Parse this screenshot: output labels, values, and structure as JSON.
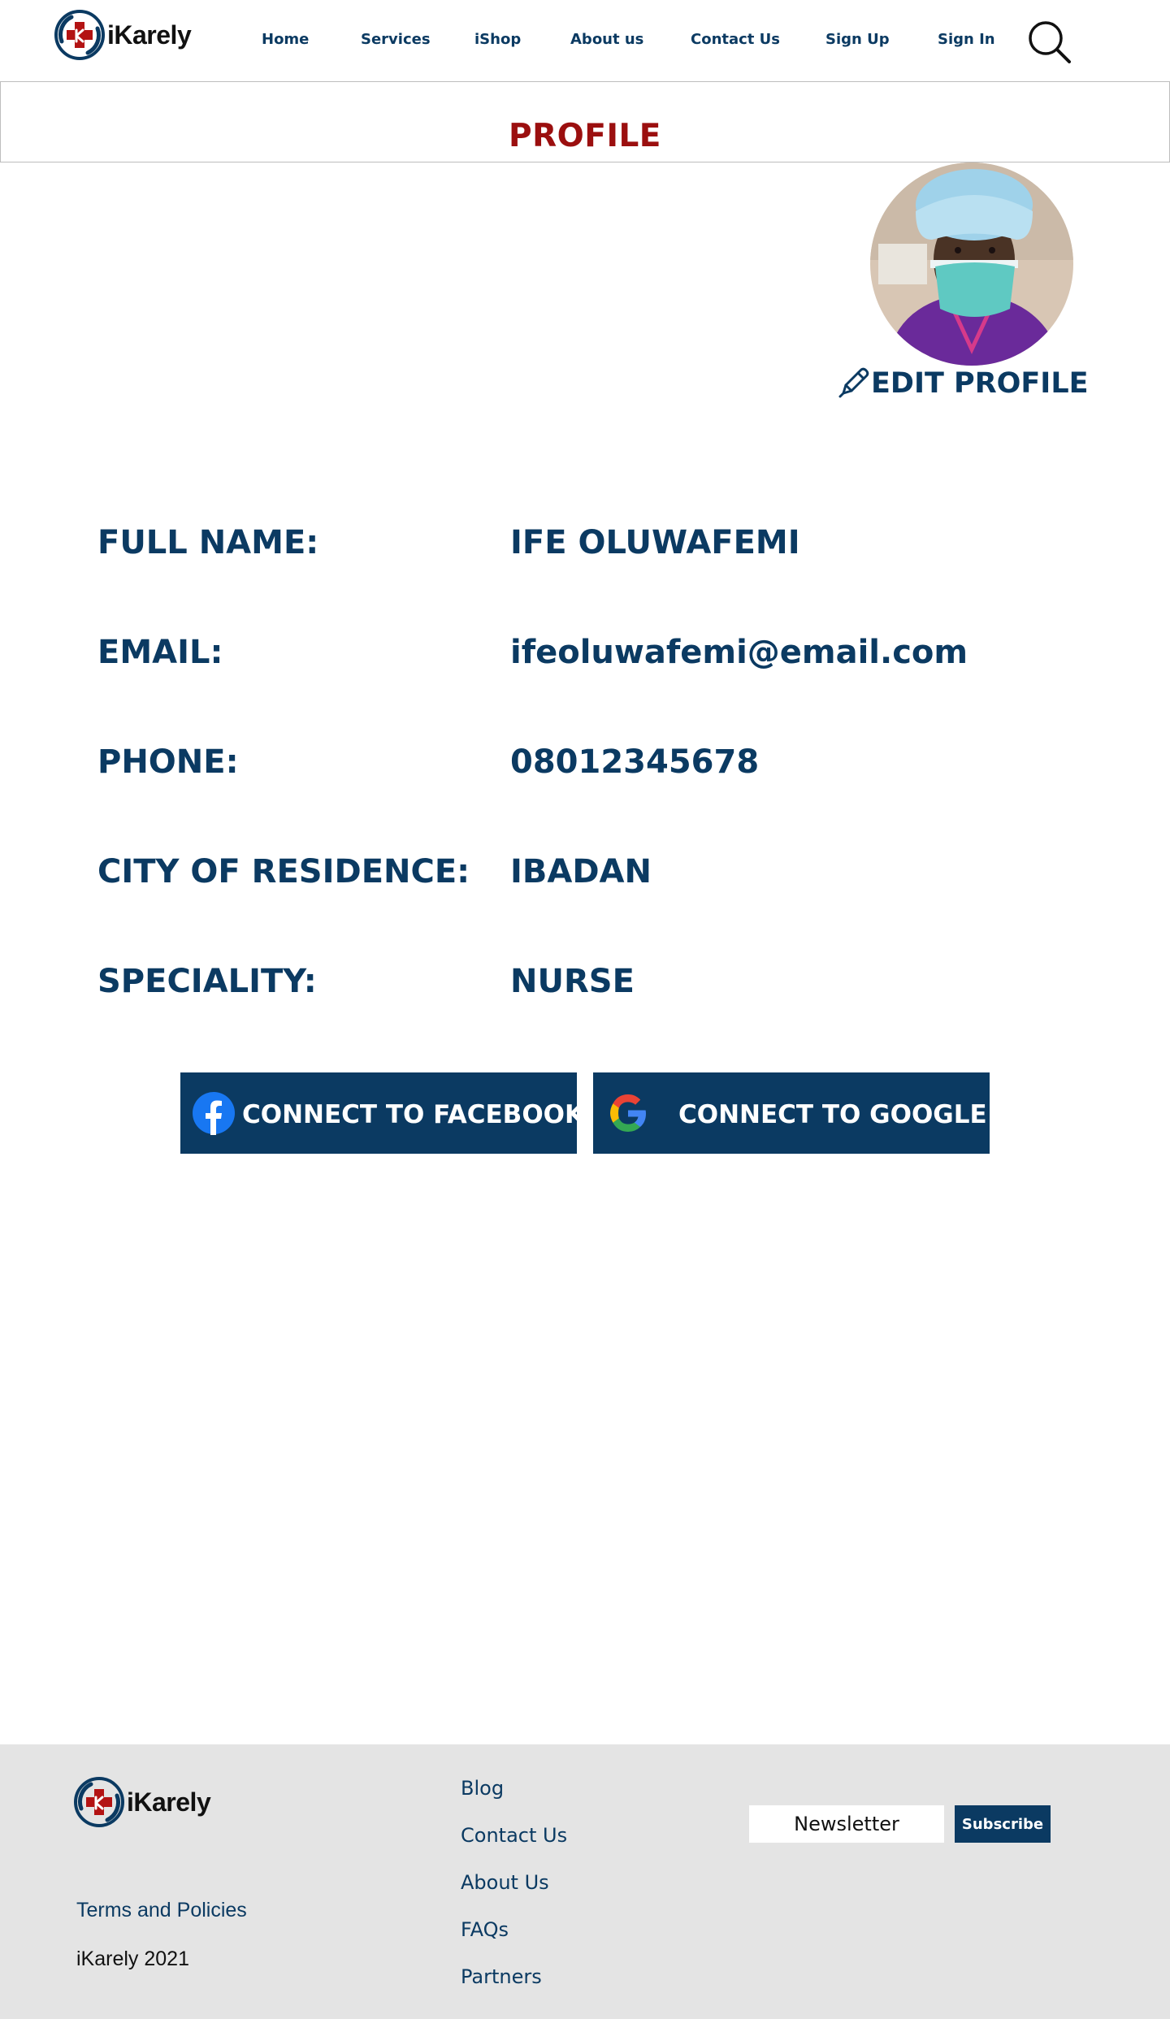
{
  "brand": {
    "name": "iKarely",
    "primary_color": "#0b3a62",
    "accent_red": "#9b0f0f"
  },
  "header": {
    "logo_text": "iKarely",
    "nav": [
      {
        "label": "Home"
      },
      {
        "label": "Services"
      },
      {
        "label": "iShop"
      },
      {
        "label": "About us"
      },
      {
        "label": "Contact Us"
      },
      {
        "label": "Sign Up"
      },
      {
        "label": "Sign In"
      }
    ],
    "search_icon": "search-icon"
  },
  "page": {
    "title": "PROFILE",
    "edit_label": "EDIT PROFILE",
    "edit_icon": "pencil-icon"
  },
  "profile": {
    "fields": [
      {
        "label": "FULL NAME:",
        "value": "IFE OLUWAFEMI"
      },
      {
        "label": "EMAIL:",
        "value": "ifeoluwafemi@email.com"
      },
      {
        "label": "PHONE:",
        "value": "08012345678"
      },
      {
        "label": "CITY OF RESIDENCE:",
        "value": "IBADAN"
      },
      {
        "label": "SPECIALITY:",
        "value": "NURSE"
      }
    ]
  },
  "connect": {
    "facebook_label": "CONNECT TO FACEBOOK",
    "google_label": "CONNECT TO GOOGLE"
  },
  "footer": {
    "logo_text": "iKarely",
    "links": [
      {
        "label": "Blog"
      },
      {
        "label": "Contact Us"
      },
      {
        "label": "About Us"
      },
      {
        "label": "FAQs"
      },
      {
        "label": "Partners"
      }
    ],
    "terms_label": "Terms and Policies",
    "copyright": "iKarely 2021",
    "newsletter_placeholder": "Newsletter",
    "subscribe_label": "Subscribe"
  }
}
